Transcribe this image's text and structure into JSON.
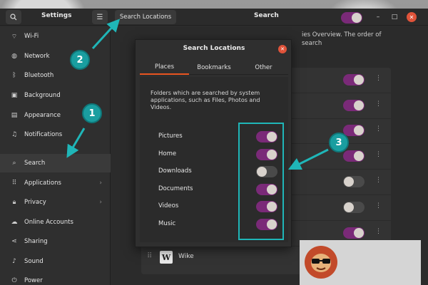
{
  "window": {
    "title": "Settings"
  },
  "header": {
    "search_locations_label": "Search Locations",
    "page_title": "Search"
  },
  "sidebar": {
    "items": [
      {
        "label": "Wi-Fi",
        "icon": "wifi-icon"
      },
      {
        "label": "Network",
        "icon": "network-icon"
      },
      {
        "label": "Bluetooth",
        "icon": "bluetooth-icon"
      },
      {
        "label": "Background",
        "icon": "background-icon"
      },
      {
        "label": "Appearance",
        "icon": "appearance-icon"
      },
      {
        "label": "Notifications",
        "icon": "bell-icon"
      },
      {
        "label": "Search",
        "icon": "search-icon",
        "active": true
      },
      {
        "label": "Applications",
        "icon": "grid-icon",
        "has_submenu": true
      },
      {
        "label": "Privacy",
        "icon": "lock-icon",
        "has_submenu": true
      },
      {
        "label": "Online Accounts",
        "icon": "online-accounts-icon"
      },
      {
        "label": "Sharing",
        "icon": "share-icon"
      },
      {
        "label": "Sound",
        "icon": "music-note-icon"
      },
      {
        "label": "Power",
        "icon": "power-icon"
      }
    ]
  },
  "main": {
    "description_partial": "ies Overview. The order of search",
    "bottom_app": "Wike"
  },
  "dialog": {
    "title": "Search Locations",
    "tabs": [
      "Places",
      "Bookmarks",
      "Other"
    ],
    "active_tab": "Places",
    "description": "Folders which are searched by system applications, such as Files, Photos and Videos.",
    "places": [
      {
        "label": "Pictures",
        "enabled": true
      },
      {
        "label": "Home",
        "enabled": true
      },
      {
        "label": "Downloads",
        "enabled": false
      },
      {
        "label": "Documents",
        "enabled": true
      },
      {
        "label": "Videos",
        "enabled": true
      },
      {
        "label": "Music",
        "enabled": true
      }
    ]
  },
  "callouts": [
    "1",
    "2",
    "3"
  ],
  "colors": {
    "accent_toggle": "#7a2a78",
    "tab_underline": "#e95420",
    "close_button": "#e0533a",
    "callout": "#1a9ea0",
    "highlight_box": "#1fb6b8"
  }
}
